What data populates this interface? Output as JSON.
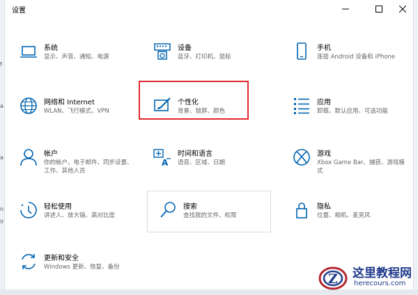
{
  "window": {
    "title": "设置"
  },
  "tiles": [
    {
      "name": "系统",
      "desc": "显示、声音、通知、电源"
    },
    {
      "name": "设备",
      "desc": "蓝牙、打印机、鼠标"
    },
    {
      "name": "手机",
      "desc": "连接 Android 设备和 iPhone"
    },
    {
      "name": "网络和 Internet",
      "desc": "WLAN、飞行模式、VPN"
    },
    {
      "name": "个性化",
      "desc": "背景、锁屏、颜色"
    },
    {
      "name": "应用",
      "desc": "卸载、默认应用、可选功能"
    },
    {
      "name": "帐户",
      "desc": "你的帐户、电子邮件、同步设置、工作、其他人员"
    },
    {
      "name": "时间和语言",
      "desc": "语音、区域、日期"
    },
    {
      "name": "游戏",
      "desc": "Xbox Game Bar、捕获、游戏模式"
    },
    {
      "name": "轻松使用",
      "desc": "讲述人、放大镜、高对比度"
    },
    {
      "name": "搜索",
      "desc": "查找我的文件、权限"
    },
    {
      "name": "隐私",
      "desc": "位置、相机、麦克风"
    },
    {
      "name": "更新和安全",
      "desc": "Windows 更新、恢复、备份"
    }
  ],
  "tile_desc_lines": {
    "account_line1": "你的帐户、电子邮件、同步设置、",
    "account_line2": "工作、其他人员",
    "gaming_line1": "Xbox Game Bar、捕获、游戏模",
    "gaming_line2": "式"
  },
  "watermark": {
    "title": "这里教程网",
    "url": "herecours.com",
    "logo_letter": "Z"
  },
  "edge_fragments": [
    "f",
    "a",
    "a",
    "n",
    "ir"
  ],
  "colors": {
    "icon_blue": "#0063b1",
    "highlight_red": "#e0262a",
    "watermark_blue": "#1f3a8a"
  }
}
